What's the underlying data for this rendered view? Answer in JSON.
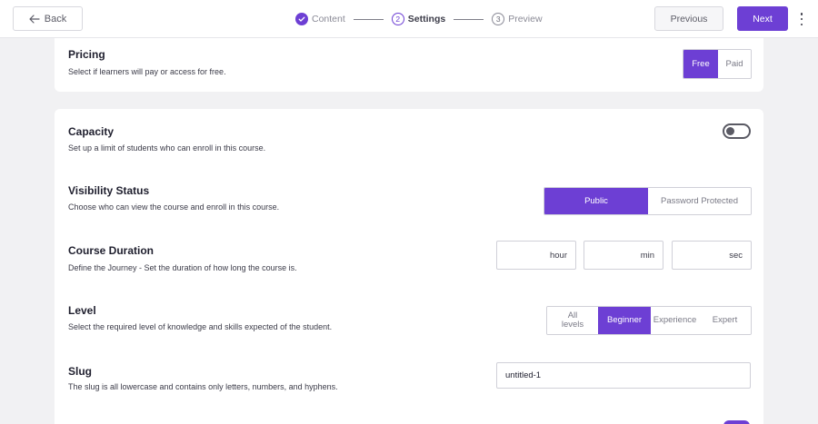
{
  "topbar": {
    "back_label": "Back",
    "steps": [
      {
        "label": "Content",
        "state": "done"
      },
      {
        "number": "2",
        "label": "Settings",
        "state": "active"
      },
      {
        "number": "3",
        "label": "Preview",
        "state": "upcoming"
      }
    ],
    "previous_label": "Previous",
    "next_label": "Next"
  },
  "pricing": {
    "title": "Pricing",
    "description": "Select if learners will pay or access for free.",
    "options": [
      "Free",
      "Paid"
    ],
    "selected": "Free"
  },
  "capacity": {
    "title": "Capacity",
    "description": "Set up a limit of students who can enroll in this course.",
    "enabled": false
  },
  "visibility": {
    "title": "Visibility Status",
    "description": "Choose who can view the course and enroll in this course.",
    "options": [
      "Public",
      "Password Protected"
    ],
    "selected": "Public"
  },
  "duration": {
    "title": "Course Duration",
    "description": "Define the Journey - Set the duration of how long the course is.",
    "units": [
      "hour",
      "min",
      "sec"
    ]
  },
  "level": {
    "title": "Level",
    "description": "Select the required level of knowledge and skills expected of the student.",
    "options": [
      "All levels",
      "Beginner",
      "Experience",
      "Expert"
    ],
    "selected": "Beginner"
  },
  "slug": {
    "title": "Slug",
    "description": "The slug is all lowercase and contains only letters, numbers, and hyphens.",
    "value": "untitled-1"
  },
  "colors": {
    "accent": "#6d3fd4",
    "background": "#f1f1f3",
    "card": "#ffffff"
  }
}
